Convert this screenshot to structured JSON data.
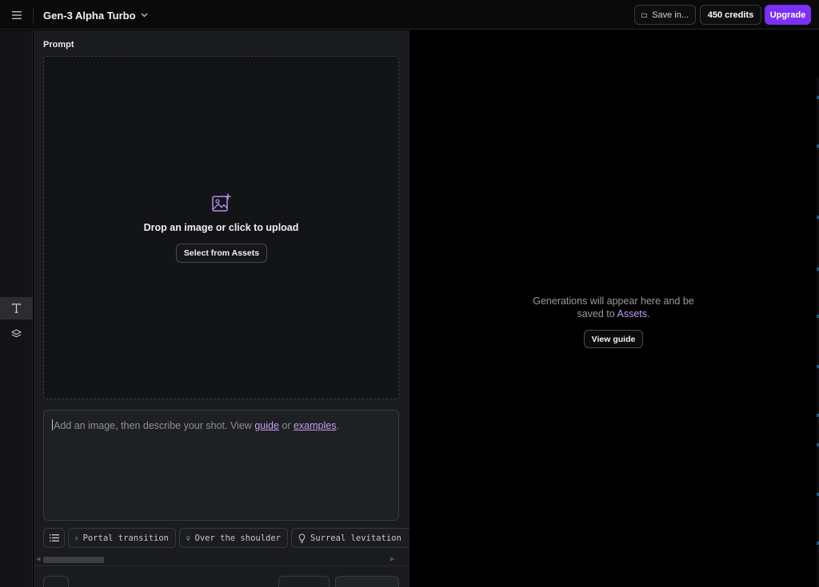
{
  "topbar": {
    "model_name": "Gen-3 Alpha Turbo",
    "save_label": "Save in...",
    "credits_label": "450 credits",
    "upgrade_label": "Upgrade"
  },
  "prompt": {
    "label": "Prompt",
    "drop_text": "Drop an image or click to upload",
    "select_assets_label": "Select from Assets",
    "text_prefix": "Add an image, then describe your shot. View ",
    "guide_link": "guide",
    "text_middle": " or ",
    "examples_link": "examples",
    "text_suffix": "."
  },
  "chips": [
    {
      "label": "Portal transition",
      "icon": "lightbulb-icon"
    },
    {
      "label": "Over the shoulder",
      "icon": "lightbulb-icon"
    },
    {
      "label": "Surreal levitation",
      "icon": "lightbulb-icon"
    }
  ],
  "stage": {
    "empty_line1": "Generations will appear here and be",
    "empty_line2_prefix": "saved to ",
    "empty_assets_link": "Assets",
    "empty_line2_suffix": ".",
    "view_guide_label": "View guide"
  },
  "colors": {
    "accent": "#7b2ff7",
    "link": "#c59cf5",
    "panel_bg": "#1a1b1f",
    "stage_bg": "#000000"
  }
}
